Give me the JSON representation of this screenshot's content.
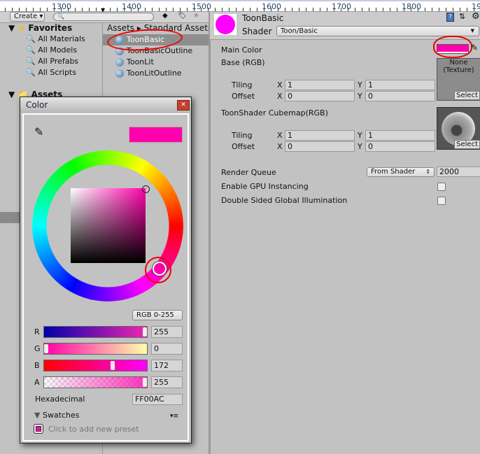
{
  "ruler": {
    "labels": [
      "1300",
      "1400",
      "1500",
      "1600",
      "1700",
      "1800",
      "19"
    ]
  },
  "project": {
    "create_label": "Create",
    "favorites": {
      "title": "Favorites",
      "items": [
        "All Materials",
        "All Models",
        "All Prefabs",
        "All Scripts"
      ]
    },
    "assets_title": "Assets",
    "breadcrumb": [
      "Assets",
      "Standard Assets"
    ],
    "files": [
      "ToonBasic",
      "ToonBasicOutline",
      "ToonLit",
      "ToonLitOutline"
    ],
    "selected": "ToonBasic"
  },
  "color_window": {
    "title": "Color",
    "preview_color": "#FF00AC",
    "mode": "RGB 0-255",
    "channels": [
      {
        "label": "R",
        "value": "255",
        "fraction": 1.0
      },
      {
        "label": "G",
        "value": "0",
        "fraction": 0.0
      },
      {
        "label": "B",
        "value": "172",
        "fraction": 0.675
      },
      {
        "label": "A",
        "value": "255",
        "fraction": 1.0
      }
    ],
    "hex_label": "Hexadecimal",
    "hex_value": "FF00AC",
    "swatches_label": "Swatches",
    "preset_hint": "Click to add new preset"
  },
  "inspector": {
    "material_name": "ToonBasic",
    "preview_color": "#FF00FF",
    "shader_label": "Shader",
    "shader_value": "Toon/Basic",
    "main_color_label": "Main Color",
    "main_color": "#FF00AC",
    "base_label": "Base (RGB)",
    "texture_none": "None\n(Texture)",
    "select_label": "Select",
    "tiling_label": "Tiling",
    "offset_label": "Offset",
    "x": "X",
    "y": "Y",
    "base_tiling": [
      "1",
      "1"
    ],
    "base_offset": [
      "0",
      "0"
    ],
    "cubemap_label": "ToonShader Cubemap(RGB)",
    "cube_tiling": [
      "1",
      "1"
    ],
    "cube_offset": [
      "0",
      "0"
    ],
    "render_queue_label": "Render Queue",
    "render_queue_mode": "From Shader",
    "render_queue_value": "2000",
    "gpu_instancing_label": "Enable GPU Instancing",
    "gpu_instancing": false,
    "double_sided_label": "Double Sided Global Illumination",
    "double_sided": false
  }
}
